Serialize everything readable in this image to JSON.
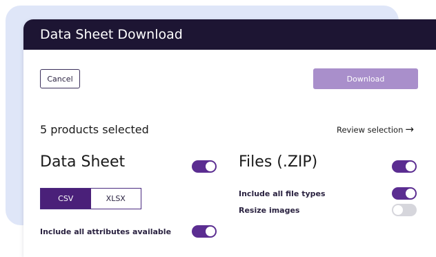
{
  "dialog": {
    "title": "Data Sheet Download",
    "cancel_label": "Cancel",
    "download_label": "Download",
    "selection_text": "5 products selected",
    "review_label": "Review selection",
    "review_arrow": "→"
  },
  "data_sheet": {
    "title": "Data Sheet",
    "enabled": true,
    "formats": [
      "CSV",
      "XLSX"
    ],
    "selected_format": "CSV",
    "include_all_attributes_label": "Include all attributes available",
    "include_all_attributes": true
  },
  "files": {
    "title": "Files (.ZIP)",
    "enabled": true,
    "include_all_types_label": "Include all file types",
    "include_all_types": true,
    "resize_images_label": "Resize images",
    "resize_images": false
  },
  "colors": {
    "header_bg": "#1d1533",
    "accent": "#5b2d91",
    "download_disabled": "#a98fcb",
    "backdrop": "#dfe6f8"
  }
}
